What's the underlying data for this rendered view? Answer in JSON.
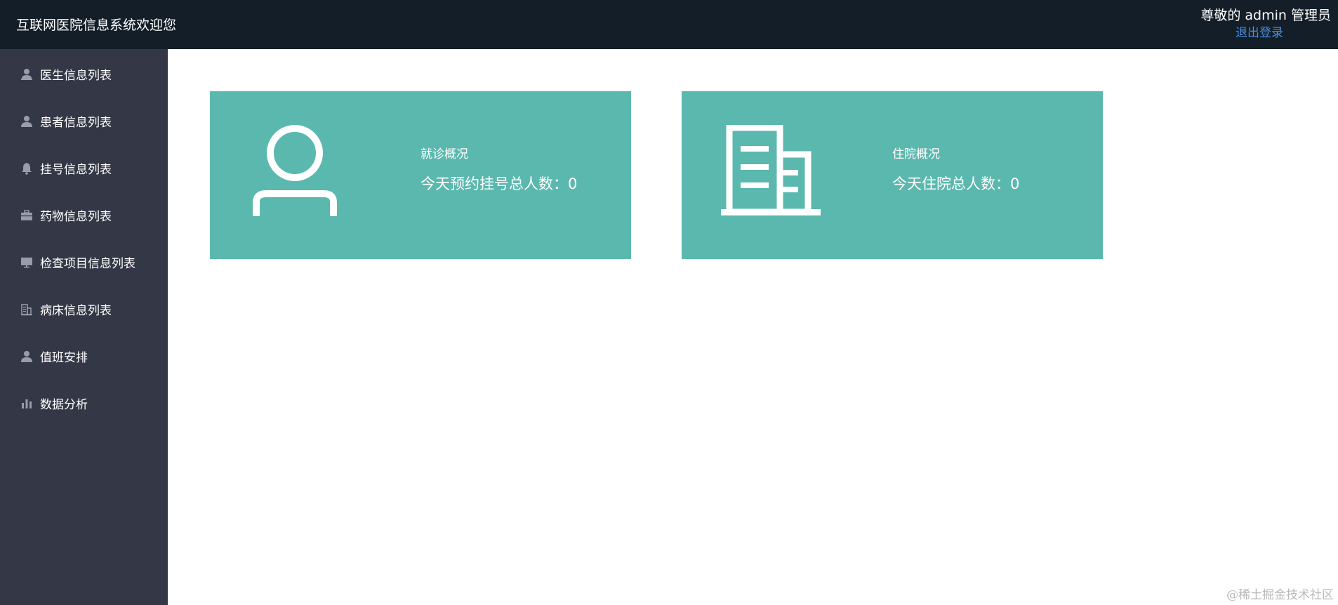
{
  "header": {
    "title": "互联网医院信息系统欢迎您",
    "greeting": "尊敬的 admin 管理员",
    "logout_label": "退出登录",
    "background": "#141e28",
    "link_color": "#4a90e2"
  },
  "sidebar": {
    "background": "#343746",
    "items": [
      {
        "label": "医生信息列表",
        "icon": "doctor-icon"
      },
      {
        "label": "患者信息列表",
        "icon": "user-icon"
      },
      {
        "label": "挂号信息列表",
        "icon": "bell-icon"
      },
      {
        "label": "药物信息列表",
        "icon": "briefcase-icon"
      },
      {
        "label": "检查项目信息列表",
        "icon": "monitor-icon"
      },
      {
        "label": "病床信息列表",
        "icon": "building-icon"
      },
      {
        "label": "值班安排",
        "icon": "user-icon"
      },
      {
        "label": "数据分析",
        "icon": "bar-chart-icon"
      }
    ]
  },
  "cards": [
    {
      "title": "就诊概况",
      "stat": "今天预约挂号总人数：0",
      "icon": "person-outline-icon"
    },
    {
      "title": "住院概况",
      "stat": "今天住院总人数：0",
      "icon": "hospital-building-icon"
    }
  ],
  "card_color": "#5bb8ae",
  "watermark": "@稀土掘金技术社区"
}
